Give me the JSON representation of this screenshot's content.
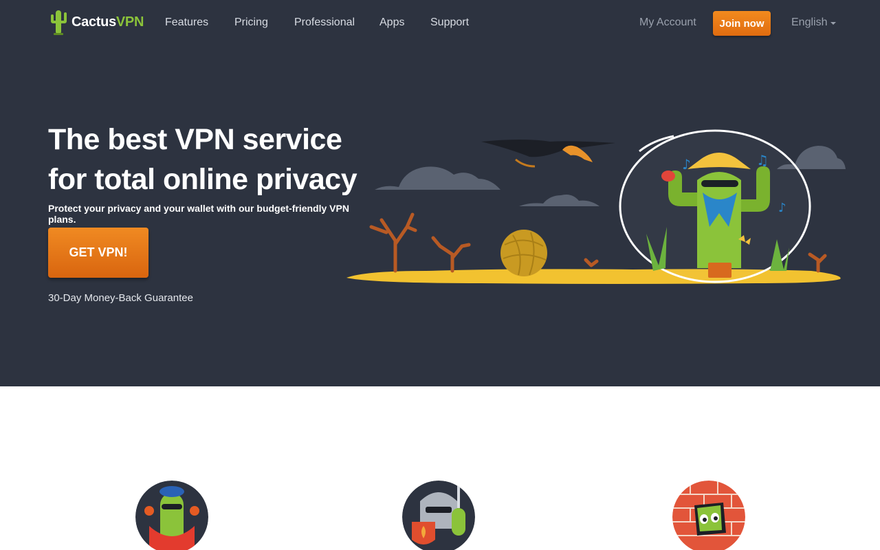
{
  "brand": {
    "name_part1": "Cactus",
    "name_part2": "VPN",
    "primary_color": "#8bc33a"
  },
  "nav": {
    "items": [
      {
        "label": "Features"
      },
      {
        "label": "Pricing"
      },
      {
        "label": "Professional"
      },
      {
        "label": "Apps"
      },
      {
        "label": "Support"
      }
    ],
    "account_label": "My Account",
    "join_label": "Join now",
    "language_label": "English"
  },
  "hero": {
    "headline_line1": "The best VPN service",
    "headline_line2": "for total online privacy",
    "subline": "Protect your privacy and your wallet with our budget-friendly VPN plans.",
    "cta_label": "GET VPN!",
    "guarantee": "30-Day Money-Back Guarantee",
    "background_color": "#2d3340",
    "accent_color": "#e8761a"
  },
  "features": {
    "badges": [
      {
        "icon": "flamenco-cactus-icon"
      },
      {
        "icon": "knight-cactus-icon"
      },
      {
        "icon": "brick-wall-cactus-icon"
      }
    ]
  }
}
